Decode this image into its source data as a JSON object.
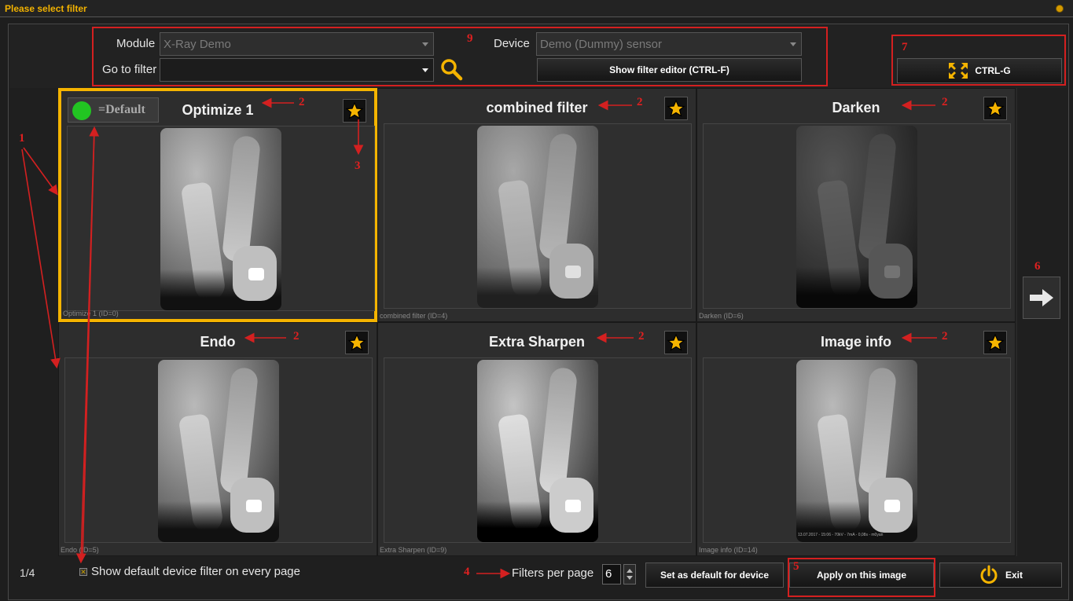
{
  "window": {
    "title": "Please select filter"
  },
  "top": {
    "module_label": "Module",
    "module_value": "X-Ray Demo",
    "goto_label": "Go to filter",
    "goto_value": "",
    "device_label": "Device",
    "device_value": "Demo (Dummy) sensor",
    "show_editor_label": "Show filter editor (CTRL-F)",
    "ctrl_g_label": "CTRL-G"
  },
  "tiles": [
    {
      "name": "Optimize 1",
      "caption": "Optimize 1 (ID=0)",
      "selected": true
    },
    {
      "name": "combined filter",
      "caption": "combined filter (ID=4)"
    },
    {
      "name": "Darken",
      "caption": "Darken (ID=6)"
    },
    {
      "name": "Endo",
      "caption": "Endo (ID=5)"
    },
    {
      "name": "Extra Sharpen",
      "caption": "Extra Sharpen (ID=9)"
    },
    {
      "name": "Image info",
      "caption": "Image info (ID=14)"
    }
  ],
  "default_badge": "=Default",
  "image_stamp": "13.07.2017 - 15:06 - 70kV - 7mA - 0,08s - m0yan",
  "bottom": {
    "page_index": "1/4",
    "show_default_label": "Show default device filter on every page",
    "filters_per_page_label": "Filters per page",
    "filters_per_page_value": "6",
    "set_default_label": "Set as default for device",
    "apply_label": "Apply on this image",
    "exit_label": "Exit"
  },
  "annotations": {
    "n1": "1",
    "n2": "2",
    "n3": "3",
    "n4": "4",
    "n5": "5",
    "n6": "6",
    "n7": "7",
    "n9": "9"
  },
  "colors": {
    "accent": "#f5b400",
    "annotation": "#d42020",
    "default_dot": "#22c522"
  },
  "icons": [
    "search-icon",
    "star-icon",
    "expand-icon",
    "arrow-right-icon",
    "power-icon",
    "checkbox-icon"
  ]
}
